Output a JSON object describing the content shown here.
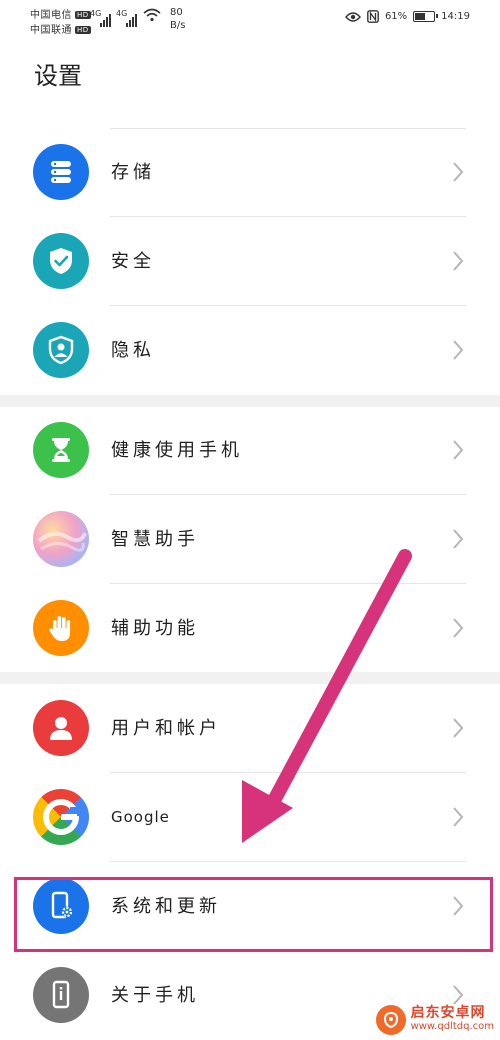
{
  "status_bar": {
    "carrier1": "中国电信",
    "carrier2": "中国联通",
    "hd": "HD",
    "signal_gen": "4G",
    "speed_value": "80",
    "speed_unit": "B/s",
    "battery_percent": "61%",
    "battery_level": 0.61,
    "time": "14:19"
  },
  "page": {
    "title": "设置"
  },
  "items": [
    {
      "label": "存储",
      "icon": "storage-icon",
      "color": "#1a73e8"
    },
    {
      "label": "安全",
      "icon": "shield-check-icon",
      "color": "#1aa6b7"
    },
    {
      "label": "隐私",
      "icon": "privacy-shield-icon",
      "color": "#1aa6b7"
    },
    {
      "label": "健康使用手机",
      "icon": "hourglass-icon",
      "color": "#3cc24a"
    },
    {
      "label": "智慧助手",
      "icon": "assistant-orb-icon",
      "color": "#e9a0d8"
    },
    {
      "label": "辅助功能",
      "icon": "hand-icon",
      "color": "#ff8f00"
    },
    {
      "label": "用户和帐户",
      "icon": "user-icon",
      "color": "#ea3c3c"
    },
    {
      "label": "Google",
      "icon": "google-icon",
      "color": "#4285f4"
    },
    {
      "label": "系统和更新",
      "icon": "system-update-icon",
      "color": "#1a73e8"
    },
    {
      "label": "关于手机",
      "icon": "phone-info-icon",
      "color": "#757575"
    }
  ],
  "watermark": {
    "name": "启东安卓网",
    "url": "www.qdltdq.com"
  }
}
